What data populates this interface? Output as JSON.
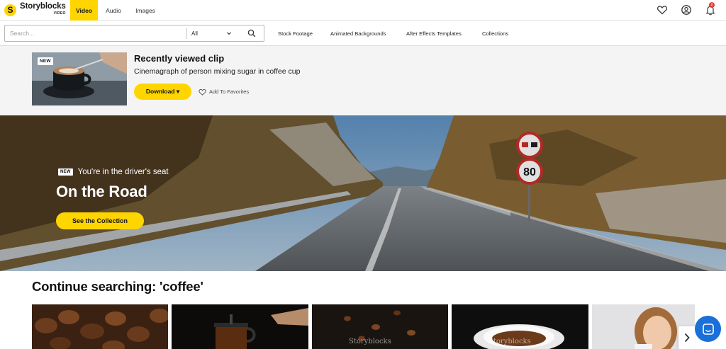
{
  "topnav": {
    "logo_name": "Storyblocks",
    "logo_sub": "VIDEO",
    "logo_glyph": "S",
    "tabs": [
      {
        "label": "Video",
        "active": true
      },
      {
        "label": "Audio",
        "active": false
      },
      {
        "label": "Images",
        "active": false
      }
    ],
    "icons": [
      "heart-icon",
      "account-icon",
      "bell-icon"
    ],
    "notification_count": "2"
  },
  "search": {
    "placeholder": "Search...",
    "value": "",
    "type_selected": "All"
  },
  "categories": [
    "Stock Footage",
    "Animated Backgrounds",
    "After Effects Templates",
    "Collections"
  ],
  "recent": {
    "thumb_tag": "NEW",
    "title": "Recently viewed clip",
    "subtitle": "Cinemagraph of person mixing sugar in coffee cup",
    "download_label": "Download ▾",
    "favorite_label": "Add To Favorites"
  },
  "hero": {
    "tag": "NEW",
    "label": "You're in the driver's seat",
    "title": "On the Road",
    "button_label": "See the Collection",
    "signs": [
      "80"
    ]
  },
  "continue": {
    "title": "Continue searching: 'coffee'",
    "watermark": "Storyblocks"
  },
  "colors": {
    "accent": "#ffd500",
    "chat": "#1a6fd8",
    "badge": "#e0413a"
  }
}
